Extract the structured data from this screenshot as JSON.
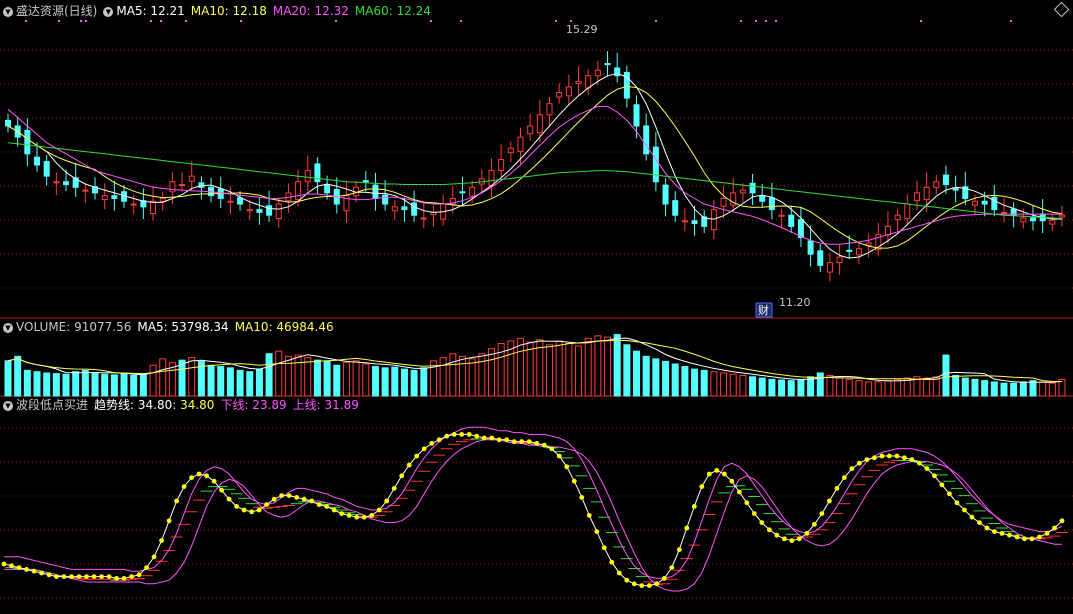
{
  "colors": {
    "background": "#000000",
    "divider": "#b02020",
    "grid": "#8b1a1a",
    "up": "#ff3b3b",
    "down": "#54ffff",
    "ma5": "#ffffff",
    "ma10": "#ffff55",
    "ma20": "#ff55ff",
    "ma60": "#33dd33",
    "text": "#c8c8c8",
    "dot": "#ffff00",
    "buy_tick": "#33dd33",
    "sell_tick": "#ff3333"
  },
  "price_panel": {
    "title": "盛达资源(日线)",
    "ma5_label": "MA5: 12.21",
    "ma10_label": "MA10: 12.18",
    "ma20_label": "MA20: 12.32",
    "ma60_label": "MA60: 12.24",
    "high_label": "15.29",
    "low_label": "11.20",
    "event_marker": "财",
    "toggle_icon": "circle-chevron-down-icon",
    "corner_icon": "diamond-icon"
  },
  "volume_panel": {
    "label": "VOLUME: 91077.56",
    "ma5_label": "MA5: 53798.34",
    "ma10_label": "MA10: 46984.46",
    "toggle_icon": "circle-chevron-down-icon"
  },
  "indicator_panel": {
    "name": "波段低点买进",
    "trend_label": "趋势线: 34.80",
    "trend_value": ": 34.80",
    "lower_label": "下线: 23.89",
    "upper_label": "上线: 31.89",
    "toggle_icon": "circle-chevron-down-icon"
  },
  "chart_data": [
    {
      "type": "candlestick",
      "title": "盛达资源(日线)",
      "series": [
        {
          "name": "MA5",
          "last": 12.21
        },
        {
          "name": "MA10",
          "last": 12.18
        },
        {
          "name": "MA20",
          "last": 12.32
        },
        {
          "name": "MA60",
          "last": 12.24
        }
      ],
      "annotations": [
        {
          "text": "15.29",
          "value": 15.29
        },
        {
          "text": "11.20",
          "value": 11.2
        }
      ],
      "ylim": [
        10.6,
        15.8
      ],
      "close": [
        13.9,
        13.7,
        13.4,
        13.2,
        13.0,
        12.9,
        12.85,
        12.8,
        12.75,
        12.7,
        12.65,
        12.6,
        12.55,
        12.5,
        12.45,
        12.55,
        12.6,
        12.9,
        12.85,
        13.0,
        12.8,
        12.65,
        12.6,
        12.55,
        12.5,
        12.4,
        12.35,
        12.3,
        12.5,
        12.7,
        12.9,
        13.1,
        12.9,
        12.7,
        12.5,
        12.65,
        12.8,
        12.9,
        12.6,
        12.5,
        12.45,
        12.4,
        12.3,
        12.25,
        12.35,
        12.5,
        12.6,
        12.7,
        12.8,
        12.95,
        13.1,
        13.3,
        13.5,
        13.7,
        13.9,
        14.1,
        14.3,
        14.5,
        14.6,
        14.7,
        14.8,
        14.9,
        15.0,
        14.8,
        14.4,
        13.9,
        13.4,
        12.9,
        12.5,
        12.3,
        12.2,
        12.15,
        12.1,
        12.4,
        12.6,
        12.7,
        12.75,
        12.7,
        12.55,
        12.4,
        12.3,
        12.1,
        11.9,
        11.6,
        11.4,
        11.45,
        11.55,
        11.65,
        11.7,
        11.8,
        11.95,
        12.1,
        12.3,
        12.5,
        12.7,
        12.8,
        12.9,
        12.85,
        12.75,
        12.6,
        12.55,
        12.5,
        12.4,
        12.35,
        12.3,
        12.25,
        12.2,
        12.2,
        12.21,
        12.3
      ],
      "ma20": [
        14.2,
        14.05,
        13.9,
        13.75,
        13.6,
        13.5,
        13.4,
        13.3,
        13.2,
        13.1,
        13.05,
        13.0,
        12.95,
        12.9,
        12.85,
        12.8,
        12.78,
        12.76,
        12.75,
        12.74,
        12.73,
        12.72,
        12.7,
        12.68,
        12.66,
        12.64,
        12.62,
        12.6,
        12.6,
        12.62,
        12.65,
        12.68,
        12.68,
        12.66,
        12.63,
        12.6,
        12.58,
        12.58,
        12.6,
        12.62,
        12.62,
        12.6,
        12.56,
        12.52,
        12.5,
        12.5,
        12.52,
        12.56,
        12.62,
        12.7,
        12.8,
        12.92,
        13.05,
        13.2,
        13.38,
        13.55,
        13.72,
        13.88,
        14.0,
        14.1,
        14.18,
        14.25,
        14.25,
        14.15,
        14.0,
        13.8,
        13.55,
        13.3,
        13.05,
        12.85,
        12.7,
        12.6,
        12.5,
        12.45,
        12.4,
        12.36,
        12.32,
        12.28,
        12.22,
        12.15,
        12.08,
        12.0,
        11.92,
        11.85,
        11.8,
        11.78,
        11.78,
        11.8,
        11.82,
        11.85,
        11.9,
        11.95,
        12.0,
        12.05,
        12.1,
        12.15,
        12.2,
        12.25,
        12.28,
        12.3,
        12.31,
        12.32,
        12.32,
        12.32,
        12.32,
        12.32,
        12.32,
        12.32,
        12.32,
        12.32
      ],
      "ma60": [
        13.6,
        13.58,
        13.56,
        13.54,
        13.52,
        13.5,
        13.48,
        13.46,
        13.44,
        13.42,
        13.4,
        13.38,
        13.36,
        13.34,
        13.32,
        13.3,
        13.28,
        13.26,
        13.24,
        13.22,
        13.2,
        13.18,
        13.16,
        13.14,
        13.12,
        13.1,
        13.08,
        13.06,
        13.04,
        13.02,
        13.0,
        12.98,
        12.96,
        12.94,
        12.92,
        12.9,
        12.89,
        12.88,
        12.87,
        12.86,
        12.86,
        12.85,
        12.85,
        12.85,
        12.85,
        12.85,
        12.86,
        12.87,
        12.88,
        12.9,
        12.92,
        12.94,
        12.96,
        12.98,
        13.0,
        13.02,
        13.04,
        13.06,
        13.07,
        13.08,
        13.09,
        13.1,
        13.1,
        13.09,
        13.08,
        13.06,
        13.04,
        13.02,
        13.0,
        12.98,
        12.96,
        12.94,
        12.92,
        12.9,
        12.88,
        12.86,
        12.84,
        12.82,
        12.8,
        12.78,
        12.76,
        12.74,
        12.72,
        12.7,
        12.68,
        12.66,
        12.64,
        12.62,
        12.6,
        12.58,
        12.56,
        12.54,
        12.52,
        12.5,
        12.48,
        12.46,
        12.44,
        12.42,
        12.4,
        12.38,
        12.36,
        12.34,
        12.32,
        12.3,
        12.29,
        12.28,
        12.27,
        12.26,
        12.25,
        12.24
      ]
    },
    {
      "type": "bar",
      "title": "VOLUME",
      "series": [
        {
          "name": "VOLUME",
          "last": 91077.56
        },
        {
          "name": "MA5",
          "last": 53798.34
        },
        {
          "name": "MA10",
          "last": 46984.46
        }
      ],
      "values": [
        55,
        62,
        40,
        38,
        36,
        35,
        34,
        38,
        40,
        36,
        34,
        33,
        35,
        32,
        33,
        48,
        58,
        52,
        56,
        60,
        54,
        48,
        46,
        44,
        40,
        38,
        42,
        66,
        70,
        62,
        64,
        60,
        56,
        54,
        48,
        52,
        55,
        50,
        46,
        44,
        45,
        42,
        40,
        44,
        55,
        60,
        66,
        62,
        58,
        66,
        74,
        82,
        86,
        90,
        84,
        88,
        80,
        86,
        82,
        78,
        90,
        94,
        92,
        96,
        80,
        70,
        62,
        58,
        54,
        50,
        46,
        42,
        40,
        38,
        36,
        34,
        32,
        30,
        28,
        26,
        25,
        24,
        26,
        30,
        36,
        32,
        28,
        26,
        24,
        22,
        22,
        24,
        26,
        28,
        30,
        28,
        30,
        64,
        32,
        28,
        26,
        24,
        22,
        20,
        20,
        22,
        24,
        22,
        20,
        26
      ],
      "ylim": [
        0,
        100
      ]
    },
    {
      "type": "line",
      "title": "波段低点买进",
      "series": [
        {
          "name": "趋势线",
          "last": 34.8
        },
        {
          "name": "下线",
          "last": 23.89
        },
        {
          "name": "上线",
          "last": 31.89
        }
      ],
      "ylim": [
        0,
        100
      ],
      "trend": [
        20,
        19,
        18,
        17,
        16,
        15,
        14,
        13,
        13,
        13,
        13,
        13,
        13,
        13,
        13,
        12,
        12,
        13,
        14,
        18,
        24,
        33,
        44,
        55,
        63,
        68,
        70,
        69,
        66,
        61,
        56,
        52,
        50,
        49,
        50,
        53,
        56,
        58,
        58,
        57,
        56,
        55,
        53,
        52,
        50,
        48,
        47,
        46,
        46,
        47,
        50,
        55,
        62,
        69,
        75,
        80,
        84,
        87,
        89,
        91,
        92,
        92,
        92,
        91,
        90,
        90,
        89,
        89,
        88,
        88,
        88,
        87,
        86,
        84,
        80,
        74,
        66,
        57,
        47,
        38,
        29,
        21,
        15,
        11,
        9,
        8,
        8,
        9,
        12,
        18,
        28,
        40,
        52,
        63,
        70,
        72,
        70,
        66,
        60,
        54,
        48,
        43,
        39,
        36,
        34,
        33,
        34,
        37,
        42,
        48,
        55,
        62,
        68,
        73,
        76,
        78,
        79,
        80,
        80,
        80,
        79,
        78,
        76,
        73,
        69,
        64,
        59,
        54,
        50,
        46,
        43,
        40,
        38,
        37,
        36,
        35,
        34,
        34,
        35,
        37,
        40,
        44
      ]
    }
  ]
}
